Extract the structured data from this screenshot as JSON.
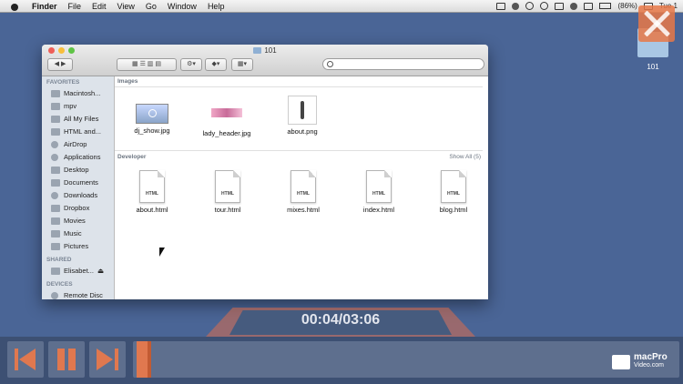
{
  "menubar": {
    "items": [
      "Finder",
      "File",
      "Edit",
      "View",
      "Go",
      "Window",
      "Help"
    ],
    "battery": "(86%)",
    "clock": "Tue 1"
  },
  "desktop": {
    "folder_label": "101"
  },
  "window": {
    "title": "101",
    "sidebar": {
      "favorites_header": "FAVORITES",
      "favorites": [
        "Macintosh...",
        "mpv",
        "All My Files",
        "HTML and...",
        "AirDrop",
        "Applications",
        "Desktop",
        "Documents",
        "Downloads",
        "Dropbox",
        "Movies",
        "Music",
        "Pictures"
      ],
      "shared_header": "SHARED",
      "shared": [
        "Elisabet..."
      ],
      "devices_header": "DEVICES",
      "devices": [
        "Remote Disc"
      ]
    },
    "sections": {
      "images_header": "Images",
      "images": [
        "dj_show.jpg",
        "lady_header.jpg",
        "about.png"
      ],
      "developer_header": "Developer",
      "show_all": "Show All (5)",
      "developer": [
        "about.html",
        "tour.html",
        "mixes.html",
        "index.html",
        "blog.html"
      ],
      "doc_badge": "HTML"
    }
  },
  "player": {
    "time": "00:04/03:06",
    "progress": 0.021,
    "logo_top": "macPro",
    "logo_bottom": "Video.com"
  },
  "colors": {
    "accent": "#e0784f",
    "desktop": "#4a6596"
  }
}
